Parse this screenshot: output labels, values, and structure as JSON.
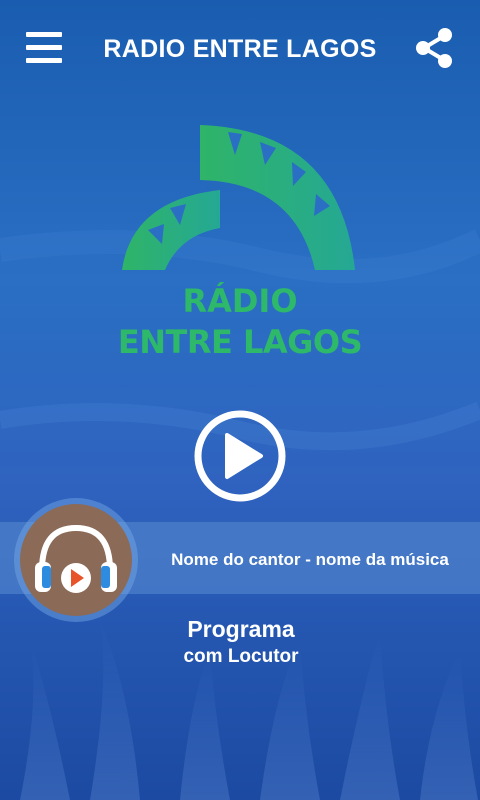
{
  "header": {
    "title": "RADIO ENTRE LAGOS",
    "menu_icon": "hamburger-menu-icon",
    "share_icon": "share-icon"
  },
  "logo": {
    "line1": "RÁDIO",
    "line2": "ENTRE LAGOS"
  },
  "player": {
    "play_icon": "play-icon",
    "now_playing": "Nome do cantor - nome da música",
    "cover_icon": "headphones-icon"
  },
  "program": {
    "name": "Programa",
    "host": "com Locutor"
  },
  "colors": {
    "background": "#2a6fc4",
    "logo_green": "#2db86a",
    "cover_brown": "#8b6a57",
    "accent_orange": "#e8542a"
  }
}
